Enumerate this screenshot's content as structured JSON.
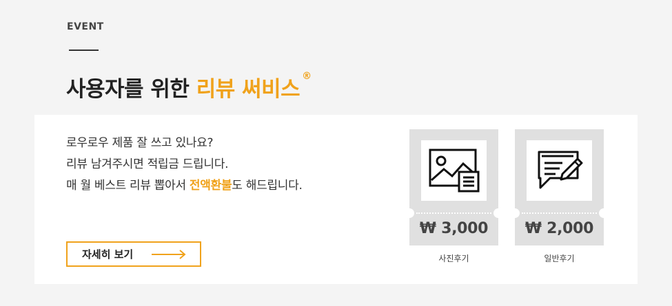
{
  "event_label": "EVENT",
  "headline": {
    "prefix": "사용자를 위한 ",
    "accent": "리뷰 써비스",
    "mark": "®"
  },
  "description": {
    "line1": "로우로우 제품 잘 쓰고 있나요?",
    "line2": "리뷰 남겨주시면 적립금 드립니다.",
    "line3_before": "매 월 베스트 리뷰 뽑아서 ",
    "line3_highlight": "전액환불",
    "line3_after": "도 해드립니다."
  },
  "detail_button": {
    "label": "자세히 보기",
    "icon": "arrow-right-icon"
  },
  "tickets": [
    {
      "icon": "photo-review-icon",
      "price": "₩ 3,000",
      "caption": "사진후기"
    },
    {
      "icon": "text-review-icon",
      "price": "₩ 2,000",
      "caption": "일반후기"
    }
  ],
  "colors": {
    "accent": "#f0a21b",
    "background": "#f4f4f4",
    "ticket": "#e0e0e0"
  }
}
